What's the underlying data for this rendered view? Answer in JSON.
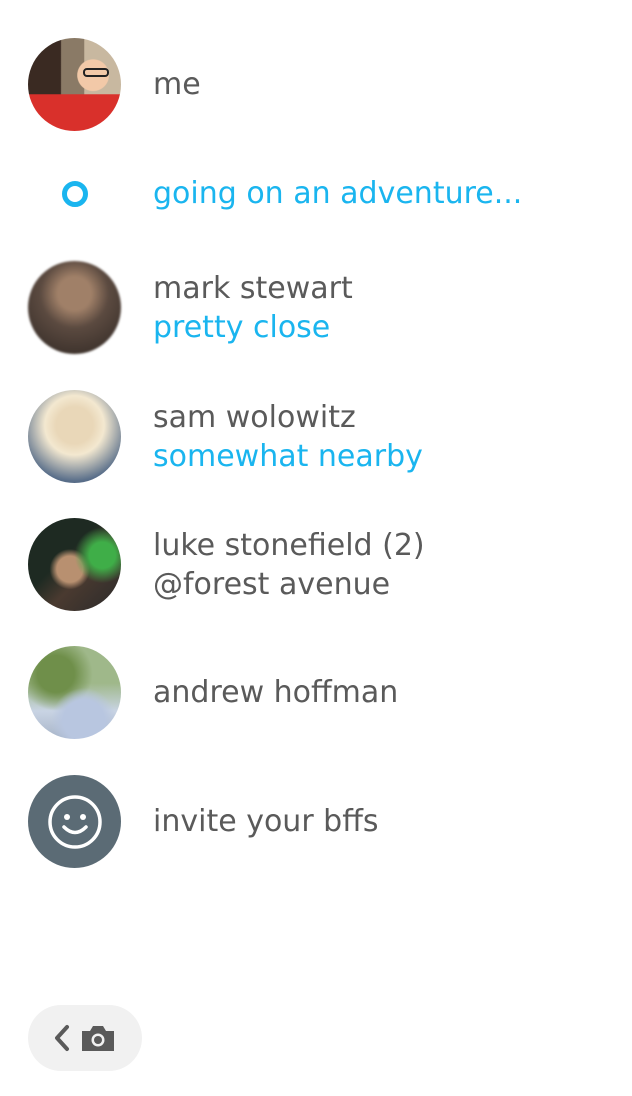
{
  "me": {
    "name": "me"
  },
  "status": {
    "text": "going on an adventure..."
  },
  "friends": [
    {
      "name": "mark stewart",
      "sub": "pretty close",
      "sub_color": "blue"
    },
    {
      "name": "sam wolowitz",
      "sub": "somewhat nearby",
      "sub_color": "blue"
    },
    {
      "name": "luke stonefield (2)",
      "sub": "@forest avenue",
      "sub_color": "gray"
    },
    {
      "name": "andrew hoffman"
    }
  ],
  "invite": {
    "label": "invite your bffs",
    "icon": "smiley-icon"
  },
  "bottom": {
    "back_icon": "chevron-left-icon",
    "camera_icon": "camera-icon"
  },
  "colors": {
    "accent": "#1ab5ef",
    "text": "#5a5a5a",
    "invite_bg": "#5b6b75",
    "pill_bg": "#f1f1f1"
  }
}
